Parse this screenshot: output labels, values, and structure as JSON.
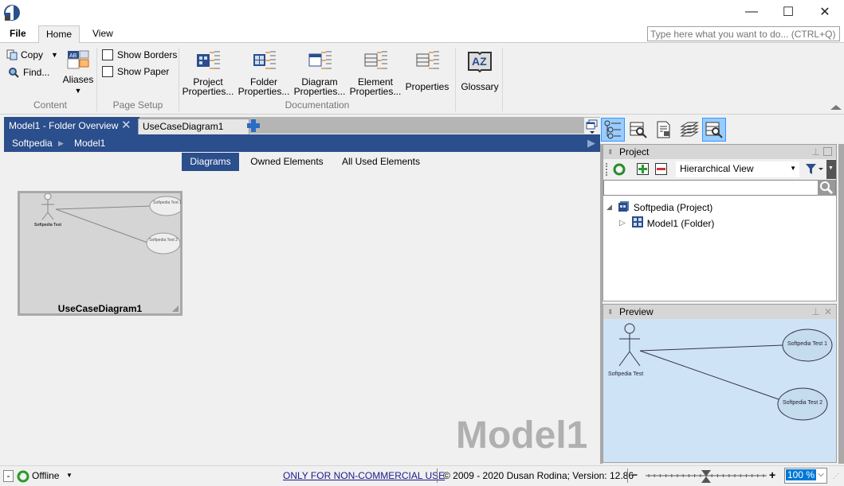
{
  "window": {
    "minimize_glyph": "—",
    "maximize_glyph": "☐",
    "close_glyph": "✕"
  },
  "menu": {
    "file": "File",
    "home": "Home",
    "view": "View"
  },
  "search": {
    "placeholder": "Type here what you want to do... (CTRL+Q)"
  },
  "ribbon": {
    "content": {
      "copy": "Copy",
      "find": "Find...",
      "aliases": "Aliases",
      "label": "Content"
    },
    "page_setup": {
      "show_borders": "Show Borders",
      "show_paper": "Show Paper",
      "label": "Page Setup",
      "show_borders_checked": false,
      "show_paper_checked": false
    },
    "documentation": {
      "label": "Documentation",
      "buttons": [
        {
          "line1": "Project",
          "line2": "Properties..."
        },
        {
          "line1": "Folder",
          "line2": "Properties..."
        },
        {
          "line1": "Diagram",
          "line2": "Properties..."
        },
        {
          "line1": "Element",
          "line2": "Properties..."
        },
        {
          "line1": "Properties",
          "line2": ""
        }
      ]
    },
    "glossary": "Glossary"
  },
  "doc_tabs": [
    {
      "label": "Model1 - Folder Overview",
      "active": true
    },
    {
      "label": "UseCaseDiagram1",
      "active": false
    }
  ],
  "breadcrumb": [
    "Softpedia",
    "Model1"
  ],
  "view_tabs": [
    "Diagrams",
    "Owned Elements",
    "All Used Elements"
  ],
  "diagram_thumb": {
    "title": "UseCaseDiagram1",
    "actor": "Softpedia Test",
    "use_cases": [
      "Softpedia Test 1",
      "Softpedia Test 2"
    ]
  },
  "watermark": "Model1",
  "project_panel": {
    "title": "Project",
    "view_select": "Hierarchical View",
    "search_value": "",
    "tree": [
      {
        "label": "Softpedia (Project)",
        "expanded": true,
        "level": 0
      },
      {
        "label": "Model1 (Folder)",
        "expanded": false,
        "level": 1
      }
    ]
  },
  "preview_panel": {
    "title": "Preview",
    "actor": "Softpedia Test",
    "use_cases": [
      "Softpedia Test 1",
      "Softpedia Test 2"
    ]
  },
  "status": {
    "collapse": "-",
    "connection": "Offline",
    "license_link": "ONLY FOR NON-COMMERCIAL USE",
    "copyright": "© 2009 - 2020 Dusan Rodina; Version: 12.86",
    "zoom_value": "100 %",
    "zoom_percent": 100
  },
  "colors": {
    "accent": "#2b4e8c",
    "preview_bg": "#cfe3f7",
    "selected_icon": "#99ccff"
  }
}
